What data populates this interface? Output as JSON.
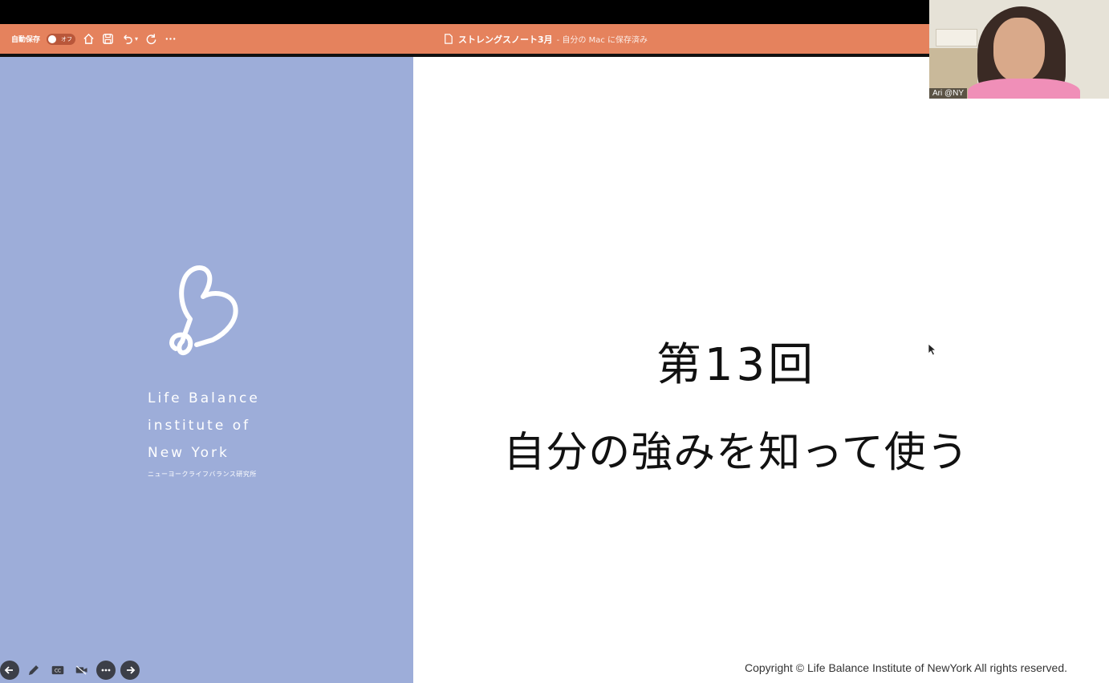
{
  "app": {
    "autosave_label": "自動保存",
    "autosave_state": "オフ",
    "document_name": "ストレングスノート3月",
    "document_status": "- 自分の Mac に保存済み"
  },
  "slide": {
    "brand_lines": [
      "Life Balance",
      "institute of",
      "New York"
    ],
    "brand_sub": "ニューヨークライフバランス研究所",
    "title_line1": "第13回",
    "title_line2": "自分の強みを知って使う",
    "copyright": "Copyright © Life Balance Institute of NewYork All rights reserved."
  },
  "video": {
    "participant_name": "Ari @NY"
  },
  "colors": {
    "titlebar": "#e5825d",
    "slide_left": "#9dadd9",
    "slide_right": "#ffffff"
  },
  "icons": {
    "toolbar": [
      "home-icon",
      "save-icon",
      "undo-icon",
      "redo-icon",
      "more-icon"
    ],
    "presenter": [
      "previous-icon",
      "pen-icon",
      "captions-icon",
      "camera-off-icon",
      "more-options-icon",
      "next-icon"
    ]
  }
}
